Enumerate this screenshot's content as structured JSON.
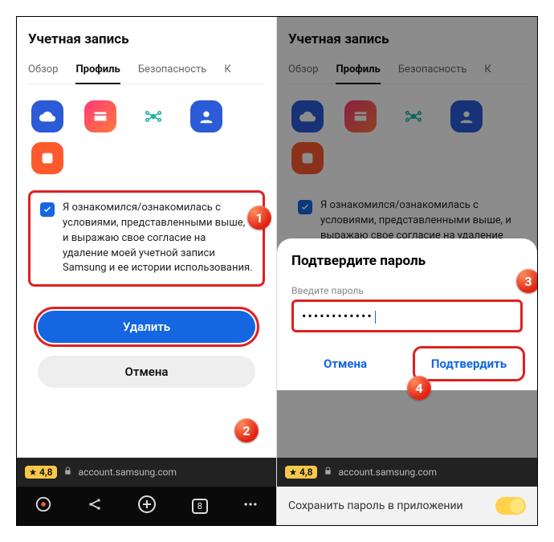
{
  "header": {
    "title": "Учетная запись"
  },
  "tabs": {
    "overview": "Обзор",
    "profile": "Профиль",
    "security": "Безопасность",
    "k": "К"
  },
  "consent": {
    "text": "Я ознакомился/ознакомилась с условиями, представленными выше, и выражаю свое согласие на удаление моей учетной записи Samsung и ее истории использования."
  },
  "buttons": {
    "delete": "Удалить",
    "cancel": "Отмена"
  },
  "sheet": {
    "title": "Подтвердите пароль",
    "label": "Введите пароль",
    "value": "••••••••••••",
    "cancel": "Отмена",
    "confirm": "Подтвердить"
  },
  "addr": {
    "rating": "4,8",
    "url": "account.samsung.com",
    "tabcount": "8"
  },
  "save": {
    "prompt": "Сохранить пароль в приложении"
  },
  "badges": {
    "b1": "1",
    "b2": "2",
    "b3": "3",
    "b4": "4"
  }
}
